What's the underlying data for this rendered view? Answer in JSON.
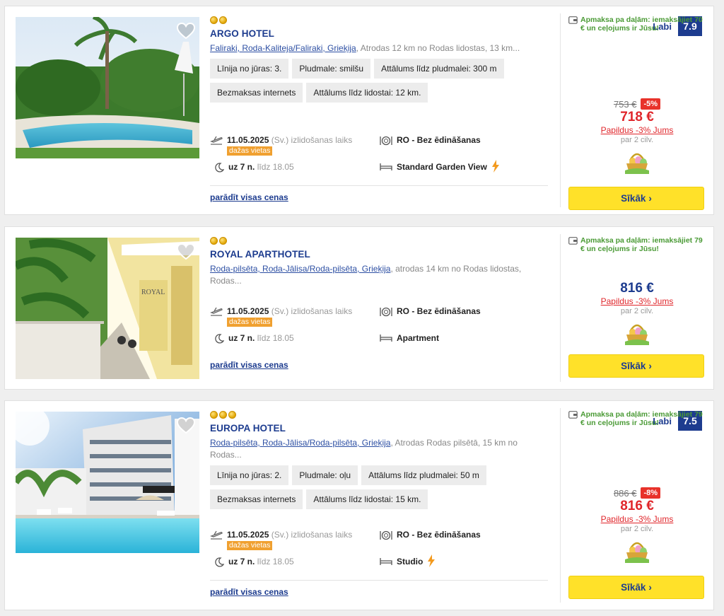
{
  "colors": {
    "brand_blue": "#1d3c8f",
    "price_red": "#e0262b",
    "green_note": "#4a9a35",
    "button_yellow": "#ffe129",
    "badge_orange": "#f0a030"
  },
  "hotels": [
    {
      "name": "ARGO HOTEL",
      "stars": 2,
      "location_link": "Faliraki, Roda-Kaliteja/Faliraki, Grieķija",
      "location_text": ", Atrodas 12 km no Rodas lidostas, 13 km...",
      "rating_label": "Labi",
      "rating_score": "7.9",
      "tags": [
        "Līnija no jūras: 3.",
        "Pludmale: smilšu",
        "Attālums līdz pludmalei: 300 m",
        "Bezmaksas internets",
        "Attālums līdz lidostai: 12 km."
      ],
      "departure_date": "11.05.2025",
      "departure_day": "(Sv.)",
      "departure_label": "izlidošanas laiks",
      "few_seats": "dažas vietas",
      "nights": "uz 7 n.",
      "until": "līdz 18.05",
      "meal": "RO - Bez ēdināšanas",
      "room": "Standard Garden View",
      "room_icon": "lightning-icon",
      "all_prices": "parādīt visas cenas",
      "installment": "Apmaksa pa daļām: iemaksājiet 70 € un ceļojums ir Jūsu!",
      "old_price": "753 €",
      "discount": "-5%",
      "price": "718 €",
      "extra_prefix": "Papildus ",
      "extra_value": "-3%",
      "extra_suffix": " Jums",
      "per_people": "par 2 cilv.",
      "button": "Sīkāk"
    },
    {
      "name": "ROYAL APARTHOTEL",
      "stars": 2,
      "location_link": "Roda-pilsēta, Roda-Jālisa/Roda-pilsēta, Grieķija",
      "location_text": ", atrodas 14 km no Rodas lidostas, Rodas...",
      "departure_date": "11.05.2025",
      "departure_day": "(Sv.)",
      "departure_label": "izlidošanas laiks",
      "few_seats": "dažas vietas",
      "nights": "uz 7 n.",
      "until": "līdz 18.05",
      "meal": "RO - Bez ēdināšanas",
      "room": "Apartment",
      "all_prices": "parādīt visas cenas",
      "installment": "Apmaksa pa daļām: iemaksājiet 79 € un ceļojums ir Jūsu!",
      "price": "816 €",
      "extra_prefix": "Papildus ",
      "extra_value": "-3%",
      "extra_suffix": " Jums",
      "per_people": "par 2 cilv.",
      "button": "Sīkāk"
    },
    {
      "name": "EUROPA HOTEL",
      "stars": 3,
      "location_link": "Roda-pilsēta, Roda-Jālisa/Roda-pilsēta, Grieķija",
      "location_text": ", Atrodas Rodas pilsētā, 15 km no Rodas...",
      "rating_label": "Labi",
      "rating_score": "7.5",
      "tags": [
        "Līnija no jūras: 2.",
        "Pludmale: oļu",
        "Attālums līdz pludmalei: 50 m",
        "Bezmaksas internets",
        "Attālums līdz lidostai: 15 km."
      ],
      "departure_date": "11.05.2025",
      "departure_day": "(Sv.)",
      "departure_label": "izlidošanas laiks",
      "few_seats": "dažas vietas",
      "nights": "uz 7 n.",
      "until": "līdz 18.05",
      "meal": "RO - Bez ēdināšanas",
      "room": "Studio",
      "room_icon": "lightning-icon",
      "all_prices": "parādīt visas cenas",
      "installment": "Apmaksa pa daļām: iemaksājiet 79 € un ceļojums ir Jūsu!",
      "old_price": "886 €",
      "discount": "-8%",
      "price": "816 €",
      "extra_prefix": "Papildus ",
      "extra_value": "-3%",
      "extra_suffix": " Jums",
      "per_people": "par 2 cilv.",
      "button": "Sīkāk"
    }
  ]
}
